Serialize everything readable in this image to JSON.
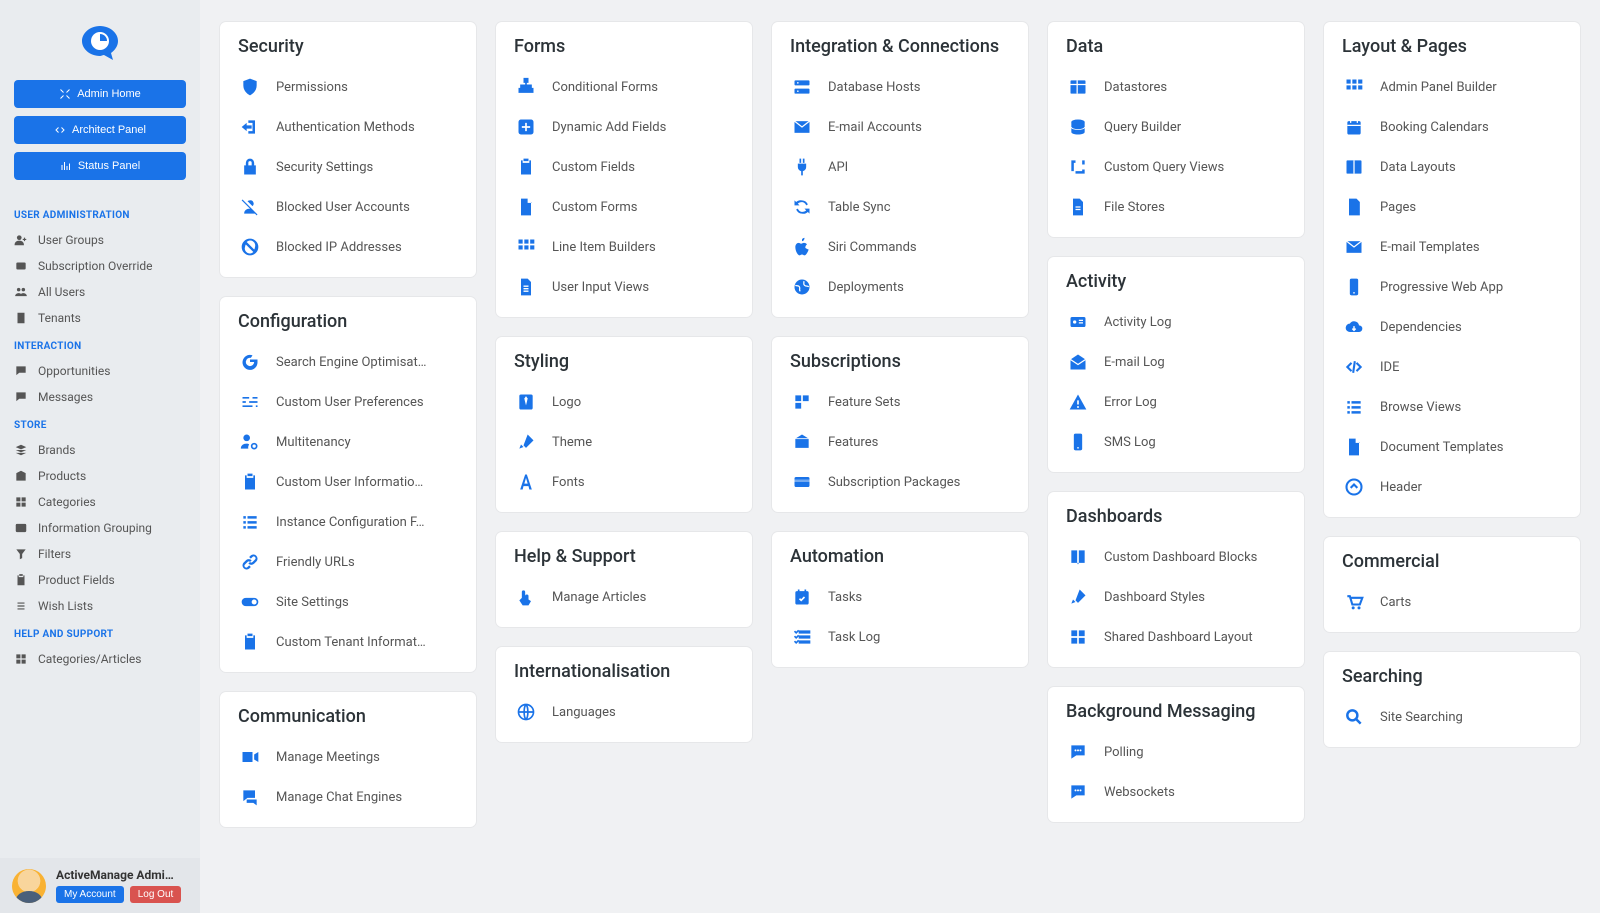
{
  "sidebar": {
    "buttons": [
      {
        "label": "Admin Home"
      },
      {
        "label": "Architect Panel"
      },
      {
        "label": "Status Panel"
      }
    ],
    "sections": [
      {
        "header": "USER ADMINISTRATION",
        "items": [
          {
            "label": "User Groups",
            "icon": "user-plus"
          },
          {
            "label": "Subscription Override",
            "icon": "badge"
          },
          {
            "label": "All Users",
            "icon": "users"
          },
          {
            "label": "Tenants",
            "icon": "building"
          }
        ]
      },
      {
        "header": "INTERACTION",
        "items": [
          {
            "label": "Opportunities",
            "icon": "chat"
          },
          {
            "label": "Messages",
            "icon": "chat"
          }
        ]
      },
      {
        "header": "STORE",
        "items": [
          {
            "label": "Brands",
            "icon": "stack"
          },
          {
            "label": "Products",
            "icon": "box"
          },
          {
            "label": "Categories",
            "icon": "grid"
          },
          {
            "label": "Information Grouping",
            "icon": "group"
          },
          {
            "label": "Filters",
            "icon": "funnel"
          },
          {
            "label": "Product Fields",
            "icon": "clipboard"
          },
          {
            "label": "Wish Lists",
            "icon": "list"
          }
        ]
      },
      {
        "header": "HELP AND SUPPORT",
        "items": [
          {
            "label": "Categories/Articles",
            "icon": "grid"
          }
        ]
      }
    ],
    "user": {
      "name": "ActiveManage Admini…",
      "account_label": "My Account",
      "logout_label": "Log Out"
    }
  },
  "columns": [
    [
      {
        "title": "Security",
        "items": [
          {
            "label": "Permissions",
            "icon": "shield"
          },
          {
            "label": "Authentication Methods",
            "icon": "login"
          },
          {
            "label": "Security Settings",
            "icon": "lock"
          },
          {
            "label": "Blocked User Accounts",
            "icon": "user-slash"
          },
          {
            "label": "Blocked IP Addresses",
            "icon": "ban"
          }
        ]
      },
      {
        "title": "Configuration",
        "items": [
          {
            "label": "Search Engine Optimisat…",
            "icon": "google"
          },
          {
            "label": "Custom User Preferences",
            "icon": "sliders"
          },
          {
            "label": "Multitenancy",
            "icon": "users-cog"
          },
          {
            "label": "Custom User Informatio…",
            "icon": "clipboard"
          },
          {
            "label": "Instance Configuration F…",
            "icon": "list-ul"
          },
          {
            "label": "Friendly URLs",
            "icon": "link"
          },
          {
            "label": "Site Settings",
            "icon": "toggle"
          },
          {
            "label": "Custom Tenant Informat…",
            "icon": "clipboard"
          }
        ]
      },
      {
        "title": "Communication",
        "items": [
          {
            "label": "Manage Meetings",
            "icon": "video"
          },
          {
            "label": "Manage Chat Engines",
            "icon": "comments"
          }
        ]
      }
    ],
    [
      {
        "title": "Forms",
        "items": [
          {
            "label": "Conditional Forms",
            "icon": "sitemap"
          },
          {
            "label": "Dynamic Add Fields",
            "icon": "plus-square"
          },
          {
            "label": "Custom Fields",
            "icon": "clipboard"
          },
          {
            "label": "Custom Forms",
            "icon": "file"
          },
          {
            "label": "Line Item Builders",
            "icon": "grid3"
          },
          {
            "label": "User Input Views",
            "icon": "file-lines"
          }
        ]
      },
      {
        "title": "Styling",
        "items": [
          {
            "label": "Logo",
            "icon": "tie"
          },
          {
            "label": "Theme",
            "icon": "brush"
          },
          {
            "label": "Fonts",
            "icon": "font"
          }
        ]
      },
      {
        "title": "Help & Support",
        "items": [
          {
            "label": "Manage Articles",
            "icon": "hand"
          }
        ]
      },
      {
        "title": "Internationalisation",
        "items": [
          {
            "label": "Languages",
            "icon": "globe"
          }
        ]
      }
    ],
    [
      {
        "title": "Integration & Connections",
        "items": [
          {
            "label": "Database Hosts",
            "icon": "server"
          },
          {
            "label": "E-mail Accounts",
            "icon": "envelope"
          },
          {
            "label": "API",
            "icon": "plug"
          },
          {
            "label": "Table Sync",
            "icon": "sync"
          },
          {
            "label": "Siri Commands",
            "icon": "apple"
          },
          {
            "label": "Deployments",
            "icon": "world"
          }
        ]
      },
      {
        "title": "Subscriptions",
        "items": [
          {
            "label": "Feature Sets",
            "icon": "boxes"
          },
          {
            "label": "Features",
            "icon": "package"
          },
          {
            "label": "Subscription Packages",
            "icon": "card"
          }
        ]
      },
      {
        "title": "Automation",
        "items": [
          {
            "label": "Tasks",
            "icon": "cal-check"
          },
          {
            "label": "Task Log",
            "icon": "checklist"
          }
        ]
      }
    ],
    [
      {
        "title": "Data",
        "items": [
          {
            "label": "Datastores",
            "icon": "table"
          },
          {
            "label": "Query Builder",
            "icon": "database"
          },
          {
            "label": "Custom Query Views",
            "icon": "crop"
          },
          {
            "label": "File Stores",
            "icon": "file-alt"
          }
        ]
      },
      {
        "title": "Activity",
        "items": [
          {
            "label": "Activity Log",
            "icon": "id-card"
          },
          {
            "label": "E-mail Log",
            "icon": "mail-open"
          },
          {
            "label": "Error Log",
            "icon": "warning"
          },
          {
            "label": "SMS Log",
            "icon": "phone"
          }
        ]
      },
      {
        "title": "Dashboards",
        "items": [
          {
            "label": "Custom Dashboard Blocks",
            "icon": "book"
          },
          {
            "label": "Dashboard Styles",
            "icon": "brush"
          },
          {
            "label": "Shared Dashboard Layout",
            "icon": "tiles"
          }
        ]
      },
      {
        "title": "Background Messaging",
        "items": [
          {
            "label": "Polling",
            "icon": "comment-dots"
          },
          {
            "label": "Websockets",
            "icon": "comment-dots"
          }
        ]
      }
    ],
    [
      {
        "title": "Layout & Pages",
        "items": [
          {
            "label": "Admin Panel Builder",
            "icon": "grid3"
          },
          {
            "label": "Booking Calendars",
            "icon": "calendar"
          },
          {
            "label": "Data Layouts",
            "icon": "columns"
          },
          {
            "label": "Pages",
            "icon": "page"
          },
          {
            "label": "E-mail Templates",
            "icon": "envelope"
          },
          {
            "label": "Progressive Web App",
            "icon": "phone"
          },
          {
            "label": "Dependencies",
            "icon": "cloud-down"
          },
          {
            "label": "IDE",
            "icon": "code"
          },
          {
            "label": "Browse Views",
            "icon": "list-ul"
          },
          {
            "label": "Document Templates",
            "icon": "file"
          },
          {
            "label": "Header",
            "icon": "up-circle"
          }
        ]
      },
      {
        "title": "Commercial",
        "items": [
          {
            "label": "Carts",
            "icon": "cart"
          }
        ]
      },
      {
        "title": "Searching",
        "items": [
          {
            "label": "Site Searching",
            "icon": "search"
          }
        ]
      }
    ]
  ]
}
